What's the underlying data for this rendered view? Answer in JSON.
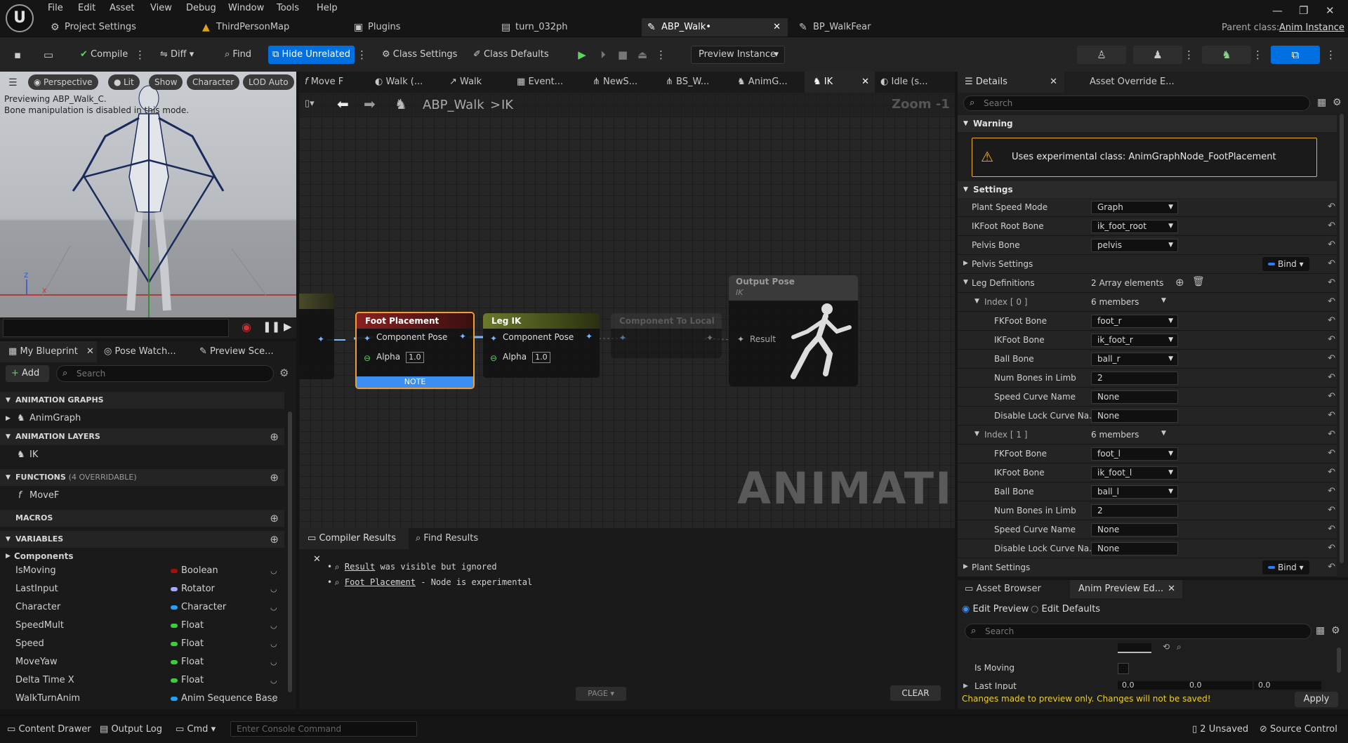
{
  "menu": [
    "File",
    "Edit",
    "Asset",
    "View",
    "Debug",
    "Window",
    "Tools",
    "Help"
  ],
  "tabs": [
    {
      "label": "Project Settings",
      "icon": "gear-icon"
    },
    {
      "label": "ThirdPersonMap",
      "icon": "level-icon"
    },
    {
      "label": "Plugins",
      "icon": "plugin-icon"
    },
    {
      "label": "turn_032ph",
      "icon": "anim-icon"
    },
    {
      "label": "ABP_Walk•",
      "icon": "anim-blueprint-icon"
    },
    {
      "label": "BP_WalkFear",
      "icon": "blueprint-icon"
    }
  ],
  "parent_class_label": "Parent class:",
  "parent_class_value": "Anim Instance",
  "toolbar": {
    "compile": "Compile",
    "diff": "Diff",
    "find": "Find",
    "hide_unrelated": "Hide Unrelated",
    "class_settings": "Class Settings",
    "class_defaults": "Class Defaults",
    "preview_instance": "Preview Instance"
  },
  "viewport": {
    "perspective": "Perspective",
    "lit": "Lit",
    "show": "Show",
    "character": "Character",
    "lod": "LOD Auto",
    "line1": "Previewing ABP_Walk_C.",
    "line2": "Bone manipulation is disabled in this mode.",
    "axis_z": "Z",
    "axis_x": "X"
  },
  "leftpanel": {
    "tabs": [
      "My Blueprint",
      "Pose Watch...",
      "Preview Sce..."
    ],
    "add": "Add",
    "search_placeholder": "Search",
    "sec_animgraphs": "ANIMATION GRAPHS",
    "animgraph": "AnimGraph",
    "sec_animlayers": "ANIMATION LAYERS",
    "ik": "IK",
    "sec_functions": "FUNCTIONS",
    "functions_note": "(4 OVERRIDABLE)",
    "movef": "MoveF",
    "sec_macros": "MACROS",
    "sec_variables": "VARIABLES",
    "components": "Components",
    "variables": [
      {
        "name": "IsMoving",
        "type": "Boolean",
        "color": "#a01010"
      },
      {
        "name": "LastInput",
        "type": "Rotator",
        "color": "#a0a8ff"
      },
      {
        "name": "Character",
        "type": "Character",
        "color": "#20a0ff"
      },
      {
        "name": "SpeedMult",
        "type": "Float",
        "color": "#38d038"
      },
      {
        "name": "Speed",
        "type": "Float",
        "color": "#38d038"
      },
      {
        "name": "MoveYaw",
        "type": "Float",
        "color": "#38d038"
      },
      {
        "name": "Delta Time X",
        "type": "Float",
        "color": "#38d038"
      },
      {
        "name": "WalkTurnAnim",
        "type": "Anim Sequence Base",
        "color": "#20a0ff"
      }
    ]
  },
  "graph": {
    "tabs": [
      "Move F",
      "Walk (...",
      "Walk",
      "Event...",
      "NewS...",
      "BS_W...",
      "AnimG...",
      "IK",
      "Idle (s..."
    ],
    "crumb_root": "ABP_Walk",
    "crumb_sep": ">",
    "crumb_leaf": "IK",
    "zoom": "Zoom -1",
    "foot_title": "Foot Placement",
    "component_pose": "Component Pose",
    "alpha": "Alpha",
    "alpha_val": "1.0",
    "note": "NOTE",
    "legik_title": "Leg IK",
    "comp_local": "Component To Local",
    "output_pose": "Output Pose",
    "output_sub": "IK",
    "result": "Result",
    "watermark": "ANIMATION"
  },
  "compiler": {
    "tab1": "Compiler Results",
    "tab2": "Find Results",
    "l1_link": "Result",
    "l1_text": " was visible but ignored",
    "l2_link": "Foot Placement",
    "l2_text": " - Node is experimental",
    "page": "PAGE",
    "clear": "CLEAR"
  },
  "details": {
    "tab1": "Details",
    "tab2": "Asset Override E...",
    "search_placeholder": "Search",
    "warning_cat": "Warning",
    "warning_text": "Uses experimental class: AnimGraphNode_FootPlacement",
    "settings_cat": "Settings",
    "plant_speed_mode": "Plant Speed Mode",
    "plant_speed_val": "Graph",
    "ikfoot_root": "IKFoot Root Bone",
    "ikfoot_root_val": "ik_foot_root",
    "pelvis_bone": "Pelvis Bone",
    "pelvis_bone_val": "pelvis",
    "pelvis_settings": "Pelvis Settings",
    "bind": "Bind",
    "leg_defs": "Leg Definitions",
    "leg_defs_val": "2 Array elements",
    "index0": "Index [ 0 ]",
    "index1": "Index [ 1 ]",
    "members": "6 members",
    "fkfoot": "FKFoot Bone",
    "ikfoot": "IKFoot Bone",
    "ball": "Ball Bone",
    "numbones": "Num Bones in Limb",
    "speedcurve": "Speed Curve Name",
    "disablelock": "Disable Lock Curve Na...",
    "r_fk": "foot_r",
    "r_ik": "ik_foot_r",
    "r_ball": "ball_r",
    "r_num": "2",
    "none": "None",
    "l_fk": "foot_l",
    "l_ik": "ik_foot_l",
    "l_ball": "ball_l",
    "l_num": "2",
    "plant_settings": "Plant Settings"
  },
  "assets": {
    "tab1": "Asset Browser",
    "tab2": "Anim Preview Ed...",
    "edit_preview": "Edit Preview",
    "edit_defaults": "Edit Defaults",
    "search_placeholder": "Search",
    "is_moving": "Is Moving",
    "last_input": "Last Input",
    "v1": "0.0",
    "v2": "0.0",
    "v3": "0.0",
    "warning": "Changes made to preview only. Changes will not be saved!",
    "apply": "Apply"
  },
  "status": {
    "content_drawer": "Content Drawer",
    "output_log": "Output Log",
    "cmd": "Cmd",
    "console_placeholder": "Enter Console Command",
    "unsaved": "2 Unsaved",
    "source_control": "Source Control"
  }
}
